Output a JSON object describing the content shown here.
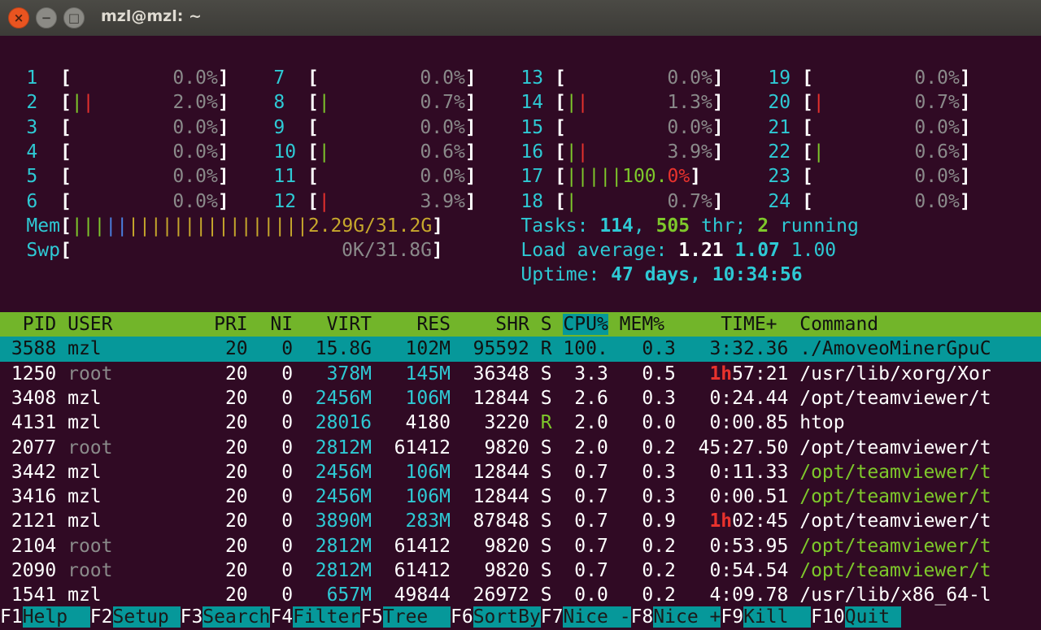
{
  "window": {
    "title": "mzl@mzl: ~",
    "close": "×",
    "minimize": "−",
    "maximize": "□"
  },
  "cpu_meters": [
    {
      "n": "1",
      "bar": [],
      "pct": "0.0%"
    },
    {
      "n": "2",
      "bar": [
        "g",
        "r"
      ],
      "pct": "2.0%"
    },
    {
      "n": "3",
      "bar": [],
      "pct": "0.0%"
    },
    {
      "n": "4",
      "bar": [],
      "pct": "0.0%"
    },
    {
      "n": "5",
      "bar": [],
      "pct": "0.0%"
    },
    {
      "n": "6",
      "bar": [],
      "pct": "0.0%"
    },
    {
      "n": "7",
      "bar": [],
      "pct": "0.0%"
    },
    {
      "n": "8",
      "bar": [
        "g"
      ],
      "pct": "0.7%"
    },
    {
      "n": "9",
      "bar": [],
      "pct": "0.0%"
    },
    {
      "n": "10",
      "bar": [
        "g"
      ],
      "pct": "0.6%"
    },
    {
      "n": "11",
      "bar": [],
      "pct": "0.0%"
    },
    {
      "n": "12",
      "bar": [
        "r"
      ],
      "pct": "3.9%"
    },
    {
      "n": "13",
      "bar": [],
      "pct": "0.0%"
    },
    {
      "n": "14",
      "bar": [
        "g",
        "r"
      ],
      "pct": "1.3%"
    },
    {
      "n": "15",
      "bar": [],
      "pct": "0.0%"
    },
    {
      "n": "16",
      "bar": [
        "g",
        "r"
      ],
      "pct": "3.9%"
    },
    {
      "n": "17",
      "bar": [
        "g",
        "g",
        "g",
        "g",
        "g"
      ],
      "pct": "100.0%",
      "full": true
    },
    {
      "n": "18",
      "bar": [
        "g"
      ],
      "pct": "0.7%"
    },
    {
      "n": "19",
      "bar": [],
      "pct": "0.0%"
    },
    {
      "n": "20",
      "bar": [
        "r"
      ],
      "pct": "0.7%"
    },
    {
      "n": "21",
      "bar": [],
      "pct": "0.0%"
    },
    {
      "n": "22",
      "bar": [
        "g"
      ],
      "pct": "0.6%"
    },
    {
      "n": "23",
      "bar": [],
      "pct": "0.0%"
    },
    {
      "n": "24",
      "bar": [],
      "pct": "0.0%"
    }
  ],
  "mem": {
    "label": "Mem",
    "value": "2.29G/31.2G"
  },
  "swap": {
    "label": "Swp",
    "value": "0K/31.8G"
  },
  "tasks": {
    "label": "Tasks:",
    "tasks": "114",
    "threads": "505",
    "thr_label": "thr;",
    "running": "2",
    "running_label": "running"
  },
  "load": {
    "label": "Load average:",
    "l1": "1.21",
    "l5": "1.07",
    "l15": "1.00"
  },
  "uptime": {
    "label": "Uptime:",
    "value": "47 days, 10:34:56"
  },
  "columns": [
    "PID",
    "USER",
    "PRI",
    "NI",
    "VIRT",
    "RES",
    "SHR",
    "S",
    "CPU%",
    "MEM%",
    "TIME+",
    "Command"
  ],
  "processes": [
    {
      "pid": "3588",
      "user": "mzl",
      "pri": "20",
      "ni": "0",
      "virt": "15.8G",
      "res": "102M",
      "shr": "95592",
      "s": "R",
      "cpu": "100.",
      "mem": "0.3",
      "time": "3:32.36",
      "cmd": "./AmoveoMinerGpuC"
    },
    {
      "pid": "1250",
      "user": "root",
      "pri": "20",
      "ni": "0",
      "virt": "378M",
      "res": "145M",
      "shr": "36348",
      "s": "S",
      "cpu": "3.3",
      "mem": "0.5",
      "time": "1h57:21",
      "cmd": "/usr/lib/xorg/Xor"
    },
    {
      "pid": "3408",
      "user": "mzl",
      "pri": "20",
      "ni": "0",
      "virt": "2456M",
      "res": "106M",
      "shr": "12844",
      "s": "S",
      "cpu": "2.6",
      "mem": "0.3",
      "time": "0:24.44",
      "cmd": "/opt/teamviewer/t"
    },
    {
      "pid": "4131",
      "user": "mzl",
      "pri": "20",
      "ni": "0",
      "virt": "28016",
      "res": "4180",
      "shr": "3220",
      "s": "R",
      "cpu": "2.0",
      "mem": "0.0",
      "time": "0:00.85",
      "cmd": "htop"
    },
    {
      "pid": "2077",
      "user": "root",
      "pri": "20",
      "ni": "0",
      "virt": "2812M",
      "res": "61412",
      "shr": "9820",
      "s": "S",
      "cpu": "2.0",
      "mem": "0.2",
      "time": "45:27.50",
      "cmd": "/opt/teamviewer/t"
    },
    {
      "pid": "3442",
      "user": "mzl",
      "pri": "20",
      "ni": "0",
      "virt": "2456M",
      "res": "106M",
      "shr": "12844",
      "s": "S",
      "cpu": "0.7",
      "mem": "0.3",
      "time": "0:11.33",
      "cmd": "/opt/teamviewer/t"
    },
    {
      "pid": "3416",
      "user": "mzl",
      "pri": "20",
      "ni": "0",
      "virt": "2456M",
      "res": "106M",
      "shr": "12844",
      "s": "S",
      "cpu": "0.7",
      "mem": "0.3",
      "time": "0:00.51",
      "cmd": "/opt/teamviewer/t"
    },
    {
      "pid": "2121",
      "user": "mzl",
      "pri": "20",
      "ni": "0",
      "virt": "3890M",
      "res": "283M",
      "shr": "87848",
      "s": "S",
      "cpu": "0.7",
      "mem": "0.9",
      "time": "1h02:45",
      "cmd": "/opt/teamviewer/t"
    },
    {
      "pid": "2104",
      "user": "root",
      "pri": "20",
      "ni": "0",
      "virt": "2812M",
      "res": "61412",
      "shr": "9820",
      "s": "S",
      "cpu": "0.7",
      "mem": "0.2",
      "time": "0:53.95",
      "cmd": "/opt/teamviewer/t"
    },
    {
      "pid": "2090",
      "user": "root",
      "pri": "20",
      "ni": "0",
      "virt": "2812M",
      "res": "61412",
      "shr": "9820",
      "s": "S",
      "cpu": "0.7",
      "mem": "0.2",
      "time": "0:54.54",
      "cmd": "/opt/teamviewer/t"
    },
    {
      "pid": "1541",
      "user": "mzl",
      "pri": "20",
      "ni": "0",
      "virt": "657M",
      "res": "49844",
      "shr": "26972",
      "s": "S",
      "cpu": "0.0",
      "mem": "0.2",
      "time": "4:09.78",
      "cmd": "/usr/lib/x86_64-l"
    }
  ],
  "function_keys": [
    {
      "key": "F1",
      "label": "Help  "
    },
    {
      "key": "F2",
      "label": "Setup "
    },
    {
      "key": "F3",
      "label": "Search"
    },
    {
      "key": "F4",
      "label": "Filter"
    },
    {
      "key": "F5",
      "label": "Tree  "
    },
    {
      "key": "F6",
      "label": "SortBy"
    },
    {
      "key": "F7",
      "label": "Nice -"
    },
    {
      "key": "F8",
      "label": "Nice +"
    },
    {
      "key": "F9",
      "label": "Kill  "
    },
    {
      "key": "F10",
      "label": "Quit "
    }
  ]
}
